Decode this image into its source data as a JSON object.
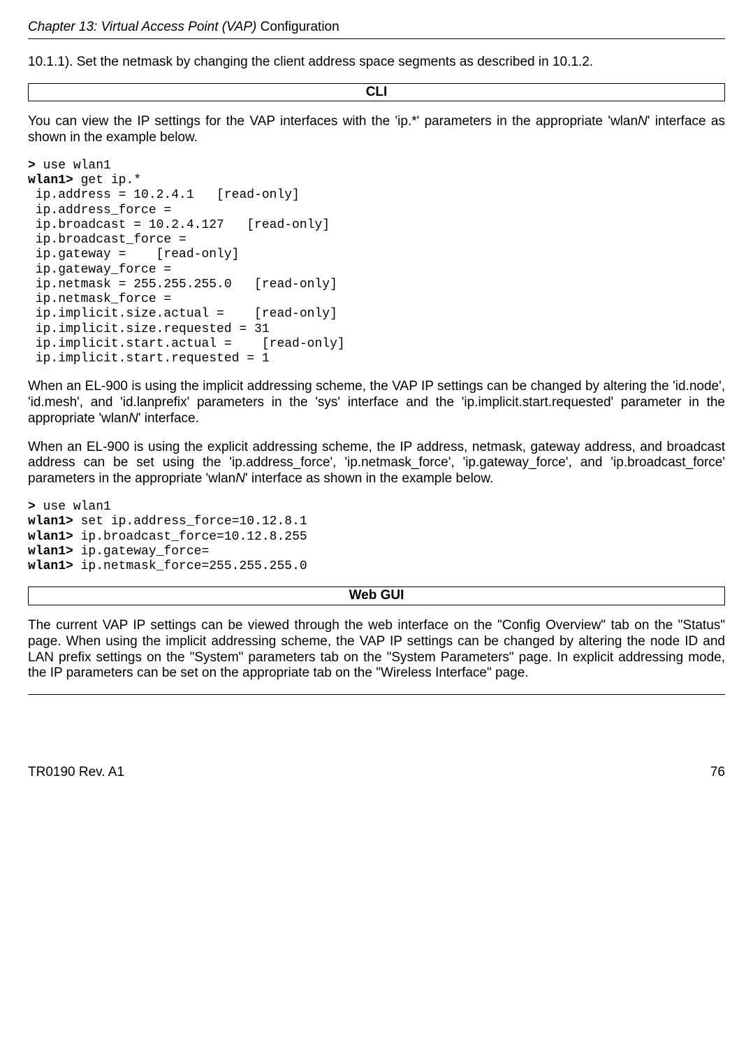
{
  "header": {
    "chapter_italic": "Chapter 13: Virtual Access Point (VAP) ",
    "chapter_plain": "Configuration"
  },
  "p1": "10.1.1). Set the netmask by changing the client address space segments as described in 10.1.2.",
  "heading_cli": "CLI",
  "p2a": "You can view the IP settings for the VAP interfaces with the 'ip.*' parameters in the appropriate 'wlan",
  "p2N": "N",
  "p2b": "' interface as shown in the example below.",
  "cli1": {
    "l1a": ">",
    "l1b": " use wlan1",
    "l2a": "wlan1>",
    "l2b": " get ip.*",
    "l3": " ip.address = 10.2.4.1   [read-only]",
    "l4": " ip.address_force = ",
    "l5": " ip.broadcast = 10.2.4.127   [read-only]",
    "l6": " ip.broadcast_force = ",
    "l7": " ip.gateway =    [read-only]",
    "l8": " ip.gateway_force = ",
    "l9": " ip.netmask = 255.255.255.0   [read-only]",
    "l10": " ip.netmask_force = ",
    "l11": " ip.implicit.size.actual =    [read-only]",
    "l12": " ip.implicit.size.requested = 31",
    "l13": " ip.implicit.start.actual =    [read-only]",
    "l14": " ip.implicit.start.requested = 1"
  },
  "p3a": "When an EL-900 is using the implicit addressing scheme, the VAP IP settings can be changed by altering the 'id.node', 'id.mesh', and 'id.lanprefix' parameters in the 'sys' interface and the 'ip.implicit.start.requested' parameter in the appropriate 'wlan",
  "p3N": "N",
  "p3b": "' interface.",
  "p4a": "When an EL-900 is using the explicit addressing scheme, the IP address, netmask, gateway address, and broadcast address can be set using the 'ip.address_force', 'ip.netmask_force', 'ip.gateway_force', and 'ip.broadcast_force' parameters in the appropriate 'wlan",
  "p4N": "N",
  "p4b": "' interface as shown in the example below.",
  "cli2": {
    "l1a": ">",
    "l1b": " use wlan1",
    "l2a": "wlan1>",
    "l2b": " set ip.address_force=10.12.8.1",
    "l3a": "wlan1>",
    "l3b": " ip.broadcast_force=10.12.8.255",
    "l4a": "wlan1>",
    "l4b": " ip.gateway_force=",
    "l5a": "wlan1>",
    "l5b": " ip.netmask_force=255.255.255.0"
  },
  "heading_web": "Web GUI",
  "p5": "The current VAP IP settings can be viewed through the web interface on the \"Config Overview\" tab on the \"Status\" page. When using the implicit addressing scheme, the VAP IP settings can be changed by altering the node ID and LAN prefix settings on the \"System\" parameters tab on the \"System Parameters\" page. In explicit addressing mode, the IP parameters can be set on the appropriate tab on the \"Wireless Interface\" page.",
  "footer": {
    "left": "TR0190 Rev. A1",
    "right": "76"
  }
}
